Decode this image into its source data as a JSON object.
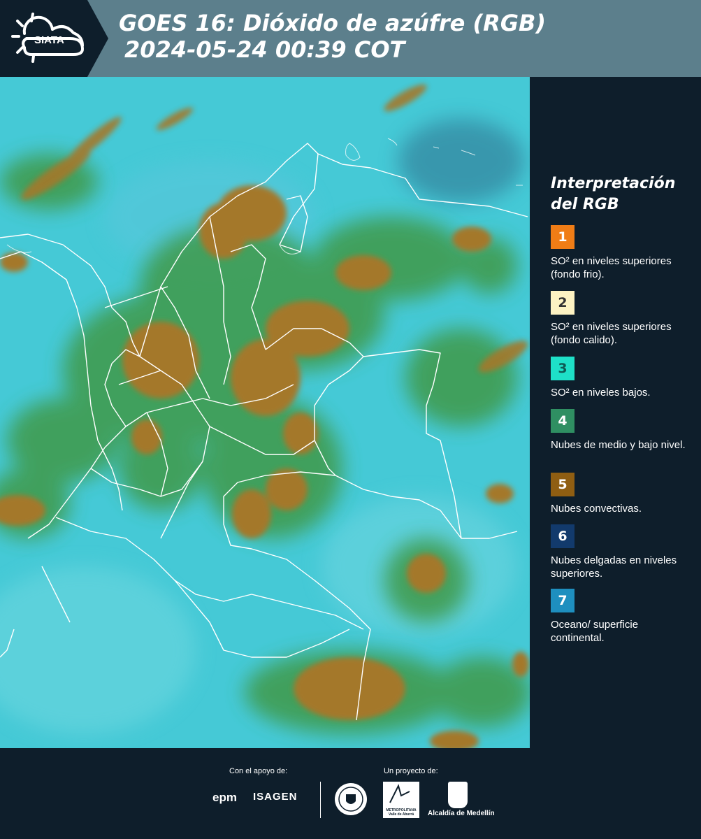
{
  "header": {
    "logo_text": "SIATA",
    "title_line1": "GOES 16: Dióxido de azúfre (RGB)",
    "title_line2": "2024-05-24 00:39 COT",
    "background_color": "#5c7f8c"
  },
  "legend": {
    "title": "Interpretación del RGB",
    "items": [
      {
        "number": "1",
        "label": "SO² en niveles superiores (fondo frio).",
        "color": "#f07d16",
        "text_color": "#ffffff"
      },
      {
        "number": "2",
        "label": "SO² en niveles superiores (fondo calido).",
        "color": "#fdf3c3",
        "text_color": "#333333"
      },
      {
        "number": "3",
        "label": "SO² en niveles bajos.",
        "color": "#1ee0c8",
        "text_color": "#0e5a54"
      },
      {
        "number": "4",
        "label": "Nubes de medio y bajo nivel.",
        "color": "#2f8f62",
        "text_color": "#ffffff"
      },
      {
        "number": "5",
        "label": "Nubes convectivas.",
        "color": "#8f5e12",
        "text_color": "#ffffff"
      },
      {
        "number": "6",
        "label": "Nubes delgadas en niveles superiores.",
        "color": "#123a6c",
        "text_color": "#ffffff"
      },
      {
        "number": "7",
        "label": "Oceano/ superficie continental.",
        "color": "#1e8fbf",
        "text_color": "#ffffff"
      }
    ]
  },
  "map": {
    "colors": {
      "ocean_surface": "#45c9d6",
      "low_clouds": "#3f9a4a",
      "convective": "#a4782a",
      "borders": "#ffffff"
    }
  },
  "footer": {
    "support_label": "Con el apoyo de:",
    "project_label": "Un proyecto de:",
    "sponsor1": "epm",
    "sponsor2": "ISAGEN",
    "area_logo_text": "METROPOLITANA Valle de Aburrá",
    "alcaldia": "Alcaldía de Medellín"
  }
}
